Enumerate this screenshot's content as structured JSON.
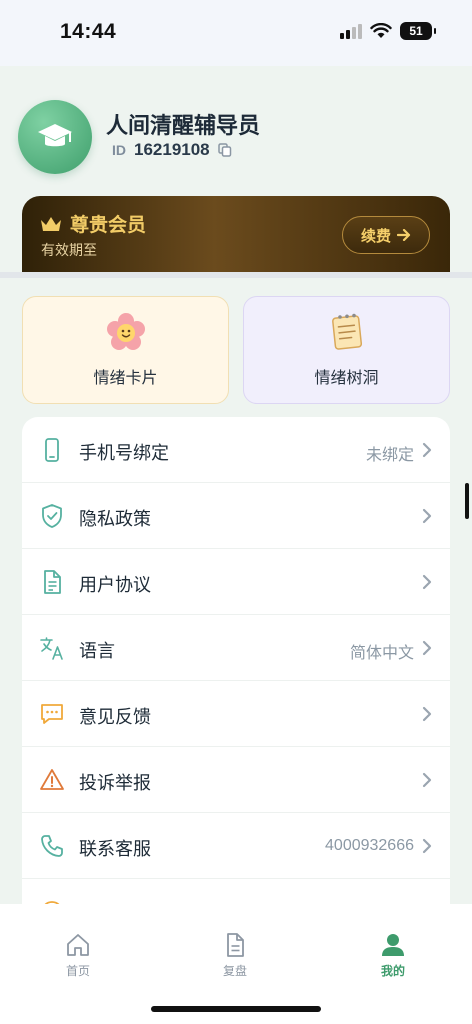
{
  "status_bar": {
    "time": "14:44",
    "battery": "51"
  },
  "profile": {
    "name": "人间清醒辅导员",
    "id_label": "ID",
    "id_value": "16219108"
  },
  "vip": {
    "title": "尊贵会员",
    "subtitle": "有效期至",
    "renew_label": "续费"
  },
  "features": [
    {
      "label": "情绪卡片",
      "icon": "flower-emoji-icon"
    },
    {
      "label": "情绪树洞",
      "icon": "notepad-icon"
    }
  ],
  "settings": [
    {
      "label": "手机号绑定",
      "value": "未绑定",
      "icon": "phone-icon"
    },
    {
      "label": "隐私政策",
      "value": "",
      "icon": "shield-check-icon"
    },
    {
      "label": "用户协议",
      "value": "",
      "icon": "document-icon"
    },
    {
      "label": "语言",
      "value": "简体中文",
      "icon": "translate-icon"
    },
    {
      "label": "意见反馈",
      "value": "",
      "icon": "chat-bubble-icon"
    },
    {
      "label": "投诉举报",
      "value": "",
      "icon": "warning-icon"
    },
    {
      "label": "联系客服",
      "value": "4000932666",
      "icon": "phone-call-icon"
    }
  ],
  "tabs": [
    {
      "label": "首页",
      "icon": "home-icon",
      "active": false
    },
    {
      "label": "复盘",
      "icon": "document-icon",
      "active": false
    },
    {
      "label": "我的",
      "icon": "user-icon",
      "active": true
    }
  ],
  "colors": {
    "accent": "#3e9b6c",
    "vip_gold": "#f2cc67",
    "background": "#eef4f0"
  }
}
